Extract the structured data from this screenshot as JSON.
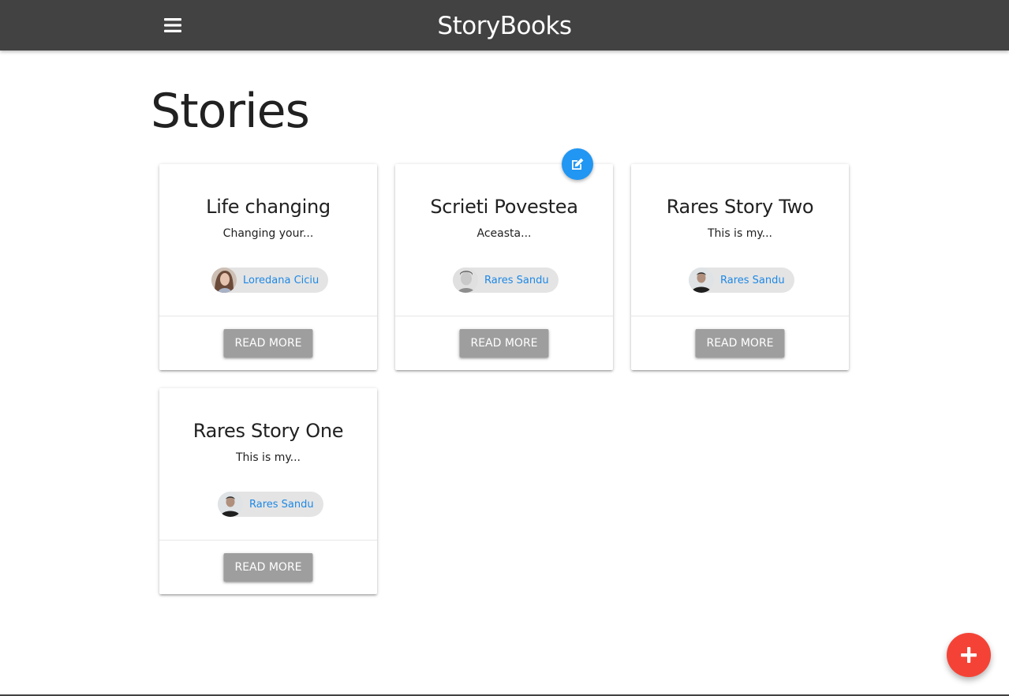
{
  "navbar": {
    "brand": "StoryBooks",
    "menu_icon": "hamburger-menu-icon",
    "background": "#424242"
  },
  "page": {
    "title": "Stories"
  },
  "stories": [
    {
      "title": "Life changing",
      "excerpt": "Changing your...",
      "author": "Loredana Ciciu",
      "action_label": "Read More"
    },
    {
      "title": "Scrieti Povestea",
      "excerpt": "Aceasta...",
      "author": "Rares Sandu",
      "action_label": "Read More",
      "edit_icon": "edit-icon"
    },
    {
      "title": "Rares Story Two",
      "excerpt": "This is my...",
      "author": "Rares Sandu",
      "action_label": "Read More"
    },
    {
      "title": "Rares Story One",
      "excerpt": "This is my...",
      "author": "Rares Sandu",
      "action_label": "Read More"
    }
  ],
  "fab": {
    "icon": "add-icon",
    "color": "#f44336"
  },
  "colors": {
    "edit_fab": "#2196f3",
    "chip_text": "#1e88e5",
    "button": "#9e9e9e"
  }
}
